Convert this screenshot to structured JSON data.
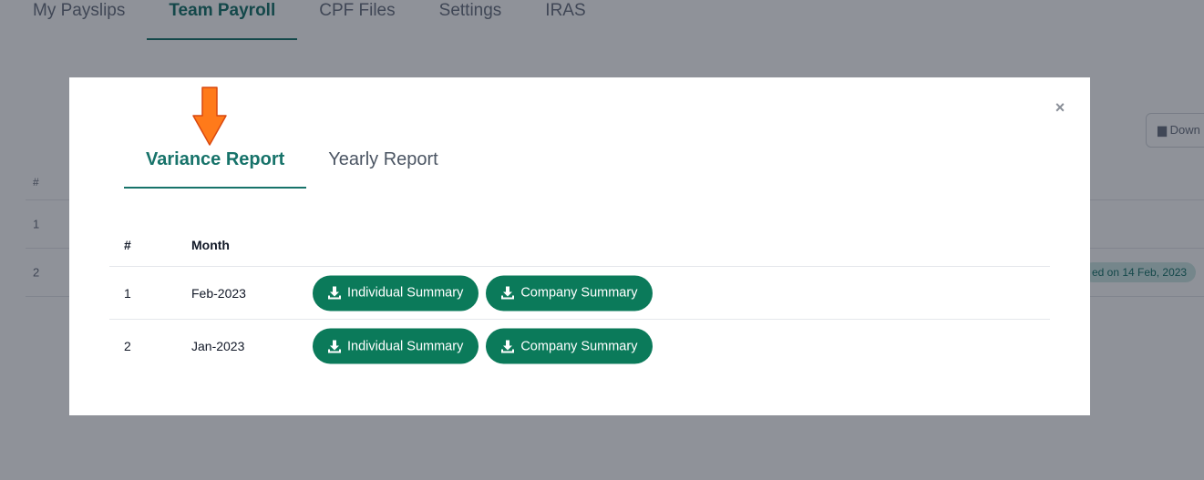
{
  "top_nav": {
    "items": [
      {
        "label": "My Payslips",
        "active": false
      },
      {
        "label": "Team Payroll",
        "active": true
      },
      {
        "label": "CPF Files",
        "active": false
      },
      {
        "label": "Settings",
        "active": false
      },
      {
        "label": "IRAS",
        "active": false
      }
    ]
  },
  "background": {
    "download_label": "Down",
    "table": {
      "header_num": "#",
      "rows": [
        {
          "num": "1",
          "badge": ""
        },
        {
          "num": "2",
          "badge": "ed on 14 Feb, 2023"
        }
      ]
    }
  },
  "modal": {
    "close_glyph": "×",
    "tabs": [
      {
        "label": "Variance Report",
        "active": true
      },
      {
        "label": "Yearly Report",
        "active": false
      }
    ],
    "table": {
      "headers": {
        "num": "#",
        "month": "Month"
      },
      "rows": [
        {
          "num": "1",
          "month": "Feb-2023",
          "individual_label": "Individual Summary",
          "company_label": "Company Summary"
        },
        {
          "num": "2",
          "month": "Jan-2023",
          "individual_label": "Individual Summary",
          "company_label": "Company Summary"
        }
      ]
    }
  },
  "icons": {
    "download": "download-icon",
    "arrow": "arrow-down-icon",
    "close": "close-icon"
  },
  "colors": {
    "accent": "#17736a",
    "button": "#0b7a5a",
    "arrow_fill": "#ff7a1a",
    "arrow_stroke": "#d9480f"
  }
}
